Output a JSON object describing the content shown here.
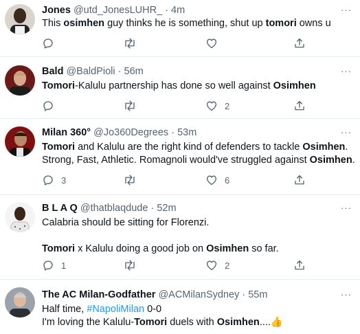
{
  "tweets": [
    {
      "name": "Jones",
      "handle": "@utd_JonesLUHR_",
      "sep": "·",
      "time": "4m",
      "text": [
        {
          "t": "This ",
          "b": false
        },
        {
          "t": "osimhen",
          "b": true
        },
        {
          "t": " guy thinks he is something, shut up ",
          "b": false
        },
        {
          "t": "tomori",
          "b": true
        },
        {
          "t": " owns u",
          "b": false
        }
      ],
      "replies": "",
      "retweets": "",
      "likes": ""
    },
    {
      "name": "Bald",
      "handle": "@BaldPioli",
      "sep": "·",
      "time": "56m",
      "text": [
        {
          "t": "Tomori",
          "b": true
        },
        {
          "t": "-Kalulu partnership has done so well against ",
          "b": false
        },
        {
          "t": "Osimhen",
          "b": true
        }
      ],
      "replies": "",
      "retweets": "",
      "likes": "2"
    },
    {
      "name": "Milan 360°",
      "handle": "@Jo360Degrees",
      "sep": "·",
      "time": "53m",
      "line1": [
        {
          "t": "Tomori",
          "b": true
        },
        {
          "t": " and Kalulu are the right kind of defenders to tackle ",
          "b": false
        },
        {
          "t": "Osimhen",
          "b": true
        },
        {
          "t": ".",
          "b": false
        }
      ],
      "line2": [
        {
          "t": "Strong, Fast, Athletic. Romagnoli would've struggled against ",
          "b": false
        },
        {
          "t": "Osimhen",
          "b": true
        },
        {
          "t": ".",
          "b": false
        }
      ],
      "replies": "3",
      "retweets": "",
      "likes": "6"
    },
    {
      "name": "B L A Q",
      "handle": "@thatblaqdude",
      "sep": "·",
      "time": "52m",
      "line1": [
        {
          "t": "Calabria should be sitting for Florenzi.",
          "b": false
        }
      ],
      "line2": [
        {
          "t": "Tomori",
          "b": true
        },
        {
          "t": " x Kalulu doing a good job on ",
          "b": false
        },
        {
          "t": "Osimhen",
          "b": true
        },
        {
          "t": " so far.",
          "b": false
        }
      ],
      "replies": "1",
      "retweets": "",
      "likes": "2"
    },
    {
      "name": "The AC Milan-Godfather",
      "handle": "@ACMilanSydney",
      "sep": "·",
      "time": "55m",
      "line1_text": "Half time, ",
      "line1_hashtag": "#NapoliMilan",
      "line1_score": " 0-0",
      "line2": [
        {
          "t": "I'm loving the Kalulu-",
          "b": false
        },
        {
          "t": "Tomori",
          "b": true
        },
        {
          "t": " duels with ",
          "b": false
        },
        {
          "t": "Osimhen",
          "b": true
        },
        {
          "t": "....",
          "b": false
        }
      ],
      "emoji": "👍"
    }
  ],
  "more_label": "···",
  "colors": {
    "text": "#0f1419",
    "secondary": "#536471",
    "hashtag": "#1d9bf0",
    "divider": "#e6ecf0"
  }
}
